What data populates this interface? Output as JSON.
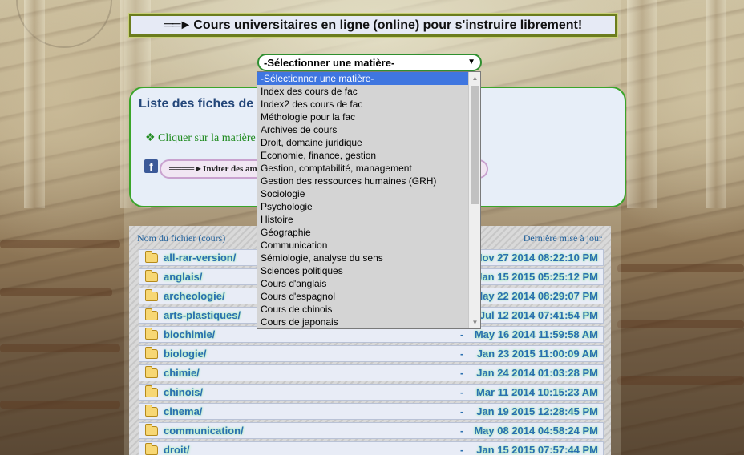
{
  "banner": {
    "arrow": "══►",
    "title": "Cours universitaires en ligne (online) pour s'instruire librement!"
  },
  "subject_select": {
    "value": "-Sélectionner une matière-",
    "caret_icon": "triangle-down"
  },
  "panel": {
    "title": "Liste des fiches de c",
    "hint": "❖ Cliquer sur la matière",
    "facebook_icon": "f",
    "invite_label": "════►Inviter des am"
  },
  "dropdown": {
    "options": [
      "-Sélectionner une matière-",
      "Index des cours de fac",
      "Index2 des cours de fac",
      "Méthologie pour la fac",
      "Archives de cours",
      "Droit, domaine juridique",
      "Economie, finance, gestion",
      "Gestion, comptabilité, management",
      "Gestion des ressources humaines (GRH)",
      "Sociologie",
      "Psychologie",
      "Histoire",
      "Géographie",
      "Communication",
      "Sémiologie, analyse du sens",
      "Sciences politiques",
      "Cours d'anglais",
      "Cours d'espagnol",
      "Cours de chinois",
      "Cours de japonais"
    ],
    "selected_index": 0
  },
  "listing": {
    "col_name": "Nom du fichier (cours)",
    "col_date": "Dernière mise à jour",
    "rows": [
      {
        "name": "all-rar-version/",
        "size": "-",
        "date": "Nov 27 2014 08:22:10 PM"
      },
      {
        "name": "anglais/",
        "size": "-",
        "date": "Jan 15 2015 05:25:12 PM"
      },
      {
        "name": "archeologie/",
        "size": "-",
        "date": "May 22 2014 08:29:07 PM"
      },
      {
        "name": "arts-plastiques/",
        "size": "-",
        "date": "Jul 12 2014 07:41:54 PM"
      },
      {
        "name": "biochimie/",
        "size": "-",
        "date": "May 16 2014 11:59:58 AM"
      },
      {
        "name": "biologie/",
        "size": "-",
        "date": "Jan 23 2015 11:00:09 AM"
      },
      {
        "name": "chimie/",
        "size": "-",
        "date": "Jan 24 2014 01:03:28 PM"
      },
      {
        "name": "chinois/",
        "size": "-",
        "date": "Mar 11 2014 10:15:23 AM"
      },
      {
        "name": "cinema/",
        "size": "-",
        "date": "Jan 19 2015 12:28:45 PM"
      },
      {
        "name": "communication/",
        "size": "-",
        "date": "May 08 2014 04:58:24 PM"
      },
      {
        "name": "droit/",
        "size": "-",
        "date": "Jan 15 2015 07:57:44 PM"
      }
    ]
  }
}
